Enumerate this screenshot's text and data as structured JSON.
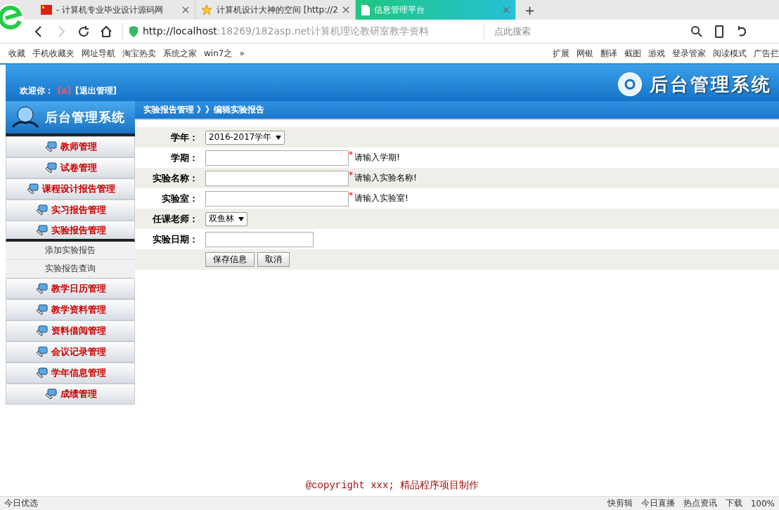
{
  "browser": {
    "tabs": [
      {
        "label": "- 计算机专业毕业设计源码网",
        "selected": false,
        "kind": "flag"
      },
      {
        "label": "计算机设计大神的空间 [http://2",
        "selected": false,
        "kind": "star"
      },
      {
        "label": "信息管理平台",
        "selected": true,
        "kind": "page"
      }
    ],
    "new_tab": "+",
    "address": {
      "host": "http://localhost",
      "rest": ":18269/182asp.net计算机理论教研室教学资料"
    },
    "search": {
      "placeholder": "点此搜索"
    },
    "bookmarks": [
      "收藏",
      "手机收藏夹",
      "网址导航",
      "淘宝热卖",
      "系统之家",
      "win7之"
    ],
    "more": "»",
    "tools": [
      "扩展",
      "网银",
      "翻译",
      "截图",
      "游戏",
      "登录管家",
      "阅读模式",
      "广告拦"
    ]
  },
  "header": {
    "welcome": "欢迎你：",
    "user": "[a]",
    "logout": "[退出管理]",
    "title": "后台管理系统"
  },
  "sidebar": {
    "logo": "后台管理系统",
    "items": [
      {
        "label": "教师管理",
        "expanded": false
      },
      {
        "label": "试卷管理",
        "expanded": false
      },
      {
        "label": "课程设计报告管理",
        "expanded": false
      },
      {
        "label": "实习报告管理",
        "expanded": false
      },
      {
        "label": "实验报告管理",
        "expanded": true,
        "children": [
          {
            "label": "添加实验报告"
          },
          {
            "label": "实验报告查询"
          }
        ]
      },
      {
        "label": "教学日历管理",
        "expanded": false
      },
      {
        "label": "教学资料管理",
        "expanded": false
      },
      {
        "label": "资料借阅管理",
        "expanded": false
      },
      {
        "label": "会议记录管理",
        "expanded": false
      },
      {
        "label": "学年信息管理",
        "expanded": false
      },
      {
        "label": "成绩管理",
        "expanded": false
      }
    ]
  },
  "breadcrumb": "实验报告管理 》》编辑实验报告",
  "form": {
    "fields": [
      {
        "label": "学年：",
        "kind": "select",
        "value": "2016-2017学年"
      },
      {
        "label": "学期：",
        "kind": "text",
        "mark": "*",
        "hint": "请输入学期!"
      },
      {
        "label": "实验名称：",
        "kind": "text",
        "mark": "*",
        "hint": "请输入实验名称!"
      },
      {
        "label": "实验室：",
        "kind": "text",
        "mark": "*",
        "hint": "请输入实验室!"
      },
      {
        "label": "任课老师：",
        "kind": "select",
        "value": "双鱼林"
      },
      {
        "label": "实验日期：",
        "kind": "date"
      }
    ],
    "buttons": [
      "保存信息",
      "取消"
    ]
  },
  "footer": "@copyright xxx; 精品程序项目制作",
  "status_bar": {
    "left": "今日优选",
    "items": [
      "快剪辑",
      "今日直播",
      "热点资讯"
    ],
    "download": "下载",
    "zoom": "100%"
  }
}
